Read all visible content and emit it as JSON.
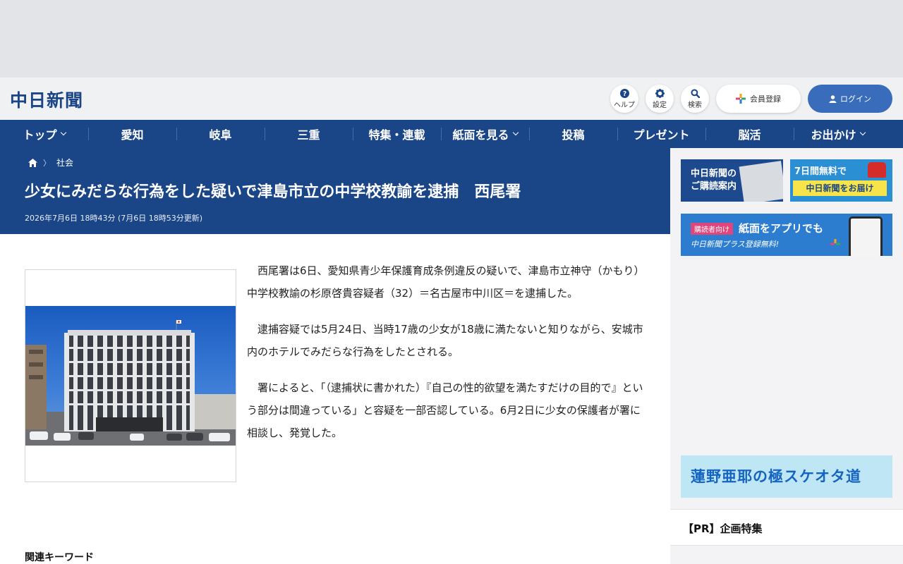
{
  "header": {
    "logo": "中日新聞",
    "help_label": "ヘルプ",
    "settings_label": "設定",
    "search_label": "検索",
    "register_label": "会員登録",
    "login_label": "ログイン"
  },
  "nav": [
    {
      "label": "トップ",
      "dropdown": true
    },
    {
      "label": "愛知",
      "dropdown": false
    },
    {
      "label": "岐阜",
      "dropdown": false
    },
    {
      "label": "三重",
      "dropdown": false
    },
    {
      "label": "特集・連載",
      "dropdown": false
    },
    {
      "label": "紙面を見る",
      "dropdown": true
    },
    {
      "label": "投稿",
      "dropdown": false
    },
    {
      "label": "プレゼント",
      "dropdown": false
    },
    {
      "label": "脳活",
      "dropdown": false
    },
    {
      "label": "お出かけ",
      "dropdown": true
    }
  ],
  "article": {
    "breadcrumb_category": "社会",
    "title": "少女にみだらな行為をした疑いで津島市立の中学校教諭を逮捕　西尾署",
    "date": "2026年7月6日 18時43分 (7月6日 18時53分更新)",
    "paragraphs": [
      "西尾署は6日、愛知県青少年保護育成条例違反の疑いで、津島市立神守（かもり）中学校教諭の杉原啓貴容疑者（32）＝名古屋市中川区＝を逮捕した。",
      "逮捕容疑では5月24日、当時17歳の少女が18歳に満たないと知りながら、安城市内のホテルでみだらな行為をしたとされる。",
      "署によると、「（逮捕状に書かれた）『自己の性的欲望を満たすだけの目的で』という部分は間違っている」と容疑を一部否認している。6月2日に少女の保護者が署に相談し、発覚した。"
    ],
    "related_keywords_label": "関連キーワード"
  },
  "sidebar": {
    "banner1": {
      "line1": "中日新聞の",
      "line2": "ご購読案内"
    },
    "banner2": {
      "line1": "7日間無料で",
      "line2": "中日新聞をお届け"
    },
    "banner3": {
      "badge": "購読者向け",
      "headline": "紙面をアプリでも",
      "sub": "中日新聞プラス登録無料!"
    },
    "banner4": {
      "text": "蓮野亜耶の極スケオタ道"
    },
    "pr_title": "【PR】企画特集"
  },
  "colors": {
    "brand_navy": "#1a4587",
    "login_blue": "#3a6cbc"
  }
}
